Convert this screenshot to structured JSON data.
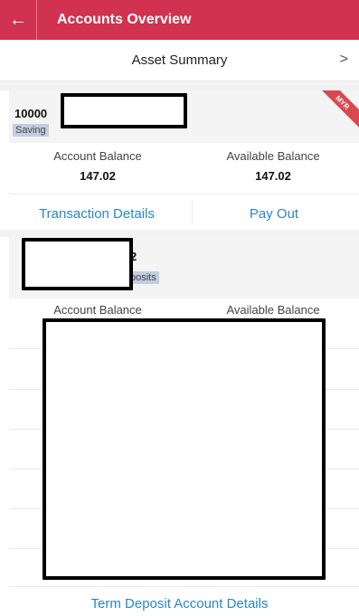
{
  "header": {
    "title": "Accounts Overview",
    "back_glyph": "←"
  },
  "asset_summary": {
    "title": "Asset Summary",
    "chevron": ">"
  },
  "account1": {
    "number_prefix": "10000",
    "type_prefix": "Saving",
    "badge": "MYR",
    "account_balance_label": "Account Balance",
    "account_balance_value": "147.02",
    "available_balance_label": "Available Balance",
    "available_balance_value": "147.02",
    "transaction_details": "Transaction Details",
    "pay_out": "Pay Out"
  },
  "account2": {
    "number_suffix": "2",
    "type_suffix": "posits",
    "account_balance_label": "Account Balance",
    "available_balance_label": "Available Balance",
    "term_deposit_details": "Term Deposit Account Details"
  },
  "colors": {
    "header": "#d0324f",
    "link": "#2a86c6",
    "badge": "#d9474f"
  }
}
